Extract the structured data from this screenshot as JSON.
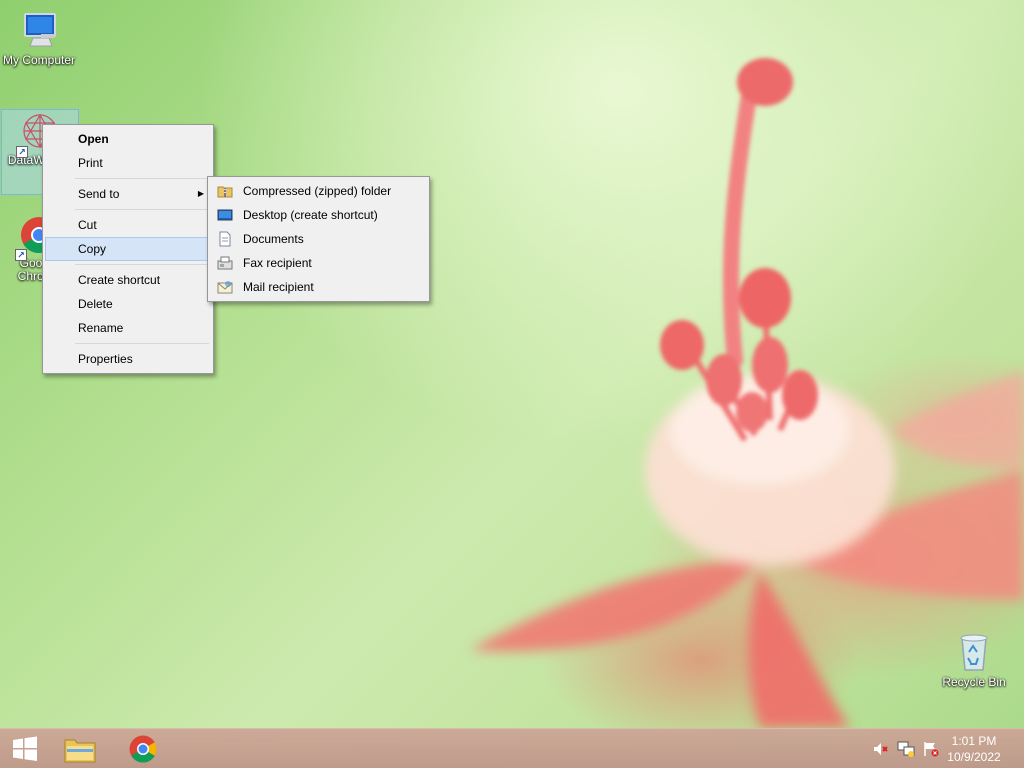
{
  "desktop": {
    "icons": [
      {
        "label": "My Computer"
      },
      {
        "label": "DataWarrior"
      },
      {
        "label": "Google Chrome"
      },
      {
        "label": "Recycle Bin"
      }
    ]
  },
  "context_menu": {
    "items": [
      {
        "label": "Open"
      },
      {
        "label": "Print"
      },
      {
        "label": "Send to"
      },
      {
        "label": "Cut"
      },
      {
        "label": "Copy"
      },
      {
        "label": "Create shortcut"
      },
      {
        "label": "Delete"
      },
      {
        "label": "Rename"
      },
      {
        "label": "Properties"
      }
    ]
  },
  "send_to_menu": {
    "items": [
      {
        "label": "Compressed (zipped) folder",
        "icon": "zip-folder-icon"
      },
      {
        "label": "Desktop (create shortcut)",
        "icon": "desktop-icon"
      },
      {
        "label": "Documents",
        "icon": "document-icon"
      },
      {
        "label": "Fax recipient",
        "icon": "fax-icon"
      },
      {
        "label": "Mail recipient",
        "icon": "mail-icon"
      }
    ]
  },
  "taskbar": {
    "clock_time": "1:01 PM",
    "clock_date": "10/9/2022"
  },
  "colors": {
    "menu_highlight": "#d5e4f7",
    "menu_background": "#f0f0f0"
  }
}
